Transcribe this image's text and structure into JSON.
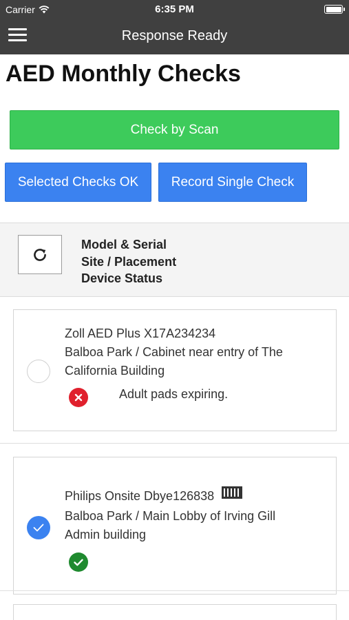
{
  "status_bar": {
    "carrier": "Carrier",
    "time": "6:35 PM"
  },
  "nav": {
    "title": "Response Ready"
  },
  "page_title": "AED Monthly Checks",
  "buttons": {
    "check_by_scan": "Check by Scan",
    "selected_checks_ok": "Selected Checks OK",
    "record_single_check": "Record Single Check"
  },
  "header": {
    "model_serial": "Model & Serial",
    "site_placement": "Site / Placement",
    "device_status": "Device Status"
  },
  "devices": [
    {
      "model_serial": "Zoll AED Plus X17A234234",
      "site_line1": "Balboa Park / Cabinet near entry of The",
      "site_line2": "California Building",
      "status": "error",
      "status_text": "Adult pads expiring.",
      "selected": false
    },
    {
      "model_serial": "Philips Onsite Dbye126838",
      "site_line1": "Balboa Park / Main Lobby of Irving Gill",
      "site_line2": "Admin building",
      "status": "ok",
      "status_text": "",
      "selected": true
    }
  ],
  "colors": {
    "bar_bg": "#404040",
    "scan_green": "#3dcb5b",
    "action_blue": "#3b82f0",
    "error_red": "#e0202d",
    "ok_green": "#1f8a2f"
  },
  "icons": [
    "wifi-icon",
    "battery-icon",
    "hamburger-menu-icon",
    "refresh-icon",
    "error-x-icon",
    "checkmark-icon",
    "barcode-icon"
  ]
}
